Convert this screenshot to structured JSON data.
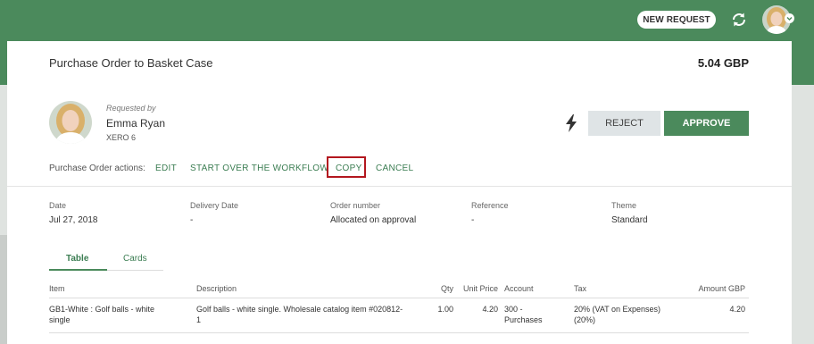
{
  "header": {
    "new_request_label": "NEW REQUEST",
    "refresh_icon": "refresh-icon",
    "avatar_icon": "user-avatar"
  },
  "order": {
    "title": "Purchase Order to Basket Case",
    "total": "5.04 GBP"
  },
  "requester": {
    "label": "Requested by",
    "name": "Emma Ryan",
    "org": "XERO 6"
  },
  "buttons": {
    "quick_icon": "lightning-icon",
    "reject": "REJECT",
    "approve": "APPROVE"
  },
  "actions": {
    "label": "Purchase Order actions:",
    "edit": "EDIT",
    "start_over": "START OVER THE WORKFLOW",
    "copy": "COPY",
    "cancel": "CANCEL"
  },
  "fields": {
    "date": {
      "label": "Date",
      "value": "Jul 27, 2018"
    },
    "delivery": {
      "label": "Delivery Date",
      "value": "-"
    },
    "order_number": {
      "label": "Order number",
      "value": "Allocated on approval"
    },
    "reference": {
      "label": "Reference",
      "value": "-"
    },
    "theme": {
      "label": "Theme",
      "value": "Standard"
    }
  },
  "tabs": [
    {
      "label": "Table",
      "active": true
    },
    {
      "label": "Cards",
      "active": false
    }
  ],
  "table": {
    "headers": {
      "item": "Item",
      "description": "Description",
      "qty": "Qty",
      "unit_price": "Unit Price",
      "account": "Account",
      "tax": "Tax",
      "amount": "Amount GBP"
    },
    "rows": [
      {
        "item_l1": "GB1-White : Golf balls - white",
        "item_l2": "single",
        "desc_l1": "Golf balls - white single. Wholesale catalog item #020812-",
        "desc_l2": "1",
        "qty": "1.00",
        "unit_price": "4.20",
        "account_l1": "300 -",
        "account_l2": "Purchases",
        "tax_l1": "20% (VAT on Expenses)",
        "tax_l2": "(20%)",
        "amount": "4.20"
      }
    ]
  },
  "colors": {
    "brand_green": "#4b8a5c",
    "link_green": "#3b7d52",
    "highlight_red": "#b3171f"
  }
}
